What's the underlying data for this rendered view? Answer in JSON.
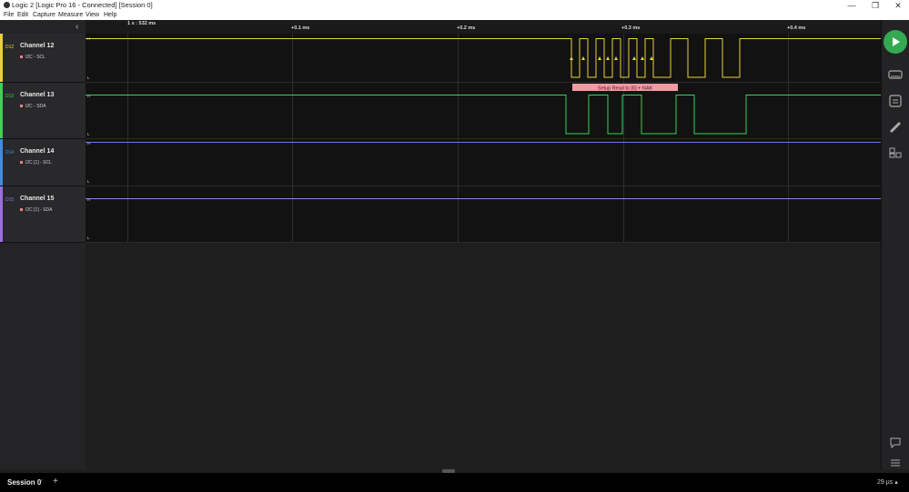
{
  "window": {
    "title": "Logic 2 [Logic Pro 16 - Connected] [Session 0]",
    "controls": {
      "minimize": "—",
      "restore": "❐",
      "close": "✕"
    }
  },
  "menu": [
    "File",
    "Edit",
    "Capture",
    "Measure",
    "View",
    "Help"
  ],
  "sidebar": {
    "collapse_glyph": "‹",
    "channels": [
      {
        "id": "D12",
        "name": "Channel 12",
        "analyzer": "I2C - SCL",
        "color": "#e8d23a"
      },
      {
        "id": "D13",
        "name": "Channel 13",
        "analyzer": "I2C - SDA",
        "color": "#3fcf5a"
      },
      {
        "id": "D14",
        "name": "Channel 14",
        "analyzer": "I2C [1] - SCL",
        "color": "#3e8de0"
      },
      {
        "id": "D15",
        "name": "Channel 15",
        "analyzer": "I2C [1] - SDA",
        "color": "#9a6fe0"
      }
    ]
  },
  "ruler": {
    "origin_label": "1 s : 532 ms",
    "ticks": [
      "+0.1 ms",
      "+0.2 ms",
      "+0.3 ms",
      "+0.4 ms"
    ]
  },
  "waveform": {
    "level_high": "H",
    "level_low": "L",
    "annotation": "Setup Read to [0] + NAK"
  },
  "rightbar": {
    "icons": [
      "play-icon",
      "device-icon",
      "analyzer-icon",
      "measure-icon",
      "extensions-icon",
      "feedback-icon",
      "menu-icon"
    ]
  },
  "bottom": {
    "session_tab": "Session 0",
    "session_close": "×",
    "add_tab": "+",
    "status": "29 µs ▴"
  }
}
